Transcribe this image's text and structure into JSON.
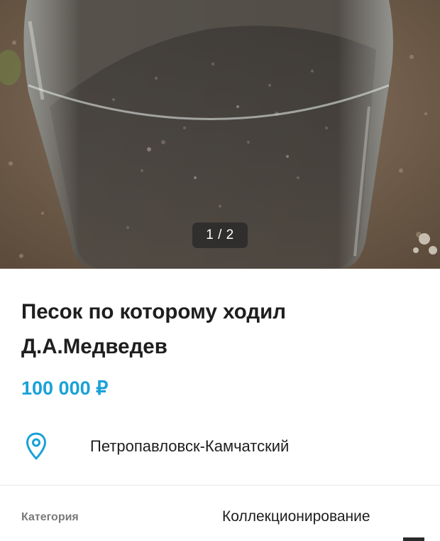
{
  "gallery": {
    "counter": "1 / 2"
  },
  "listing": {
    "title_line1": "Песок по которому ходил",
    "title_line2": "Д.А.Медведев",
    "price": "100 000 ₽",
    "location": "Петропавловск-Камчатский",
    "location_icon": "map-pin-icon"
  },
  "params": [
    {
      "label": "Категория",
      "value": "Коллекционирование"
    }
  ],
  "colors": {
    "price": "#1aa1d8",
    "location_icon": "#1aa1d8",
    "text": "#1e1e1e",
    "label": "#7a7a7a"
  }
}
